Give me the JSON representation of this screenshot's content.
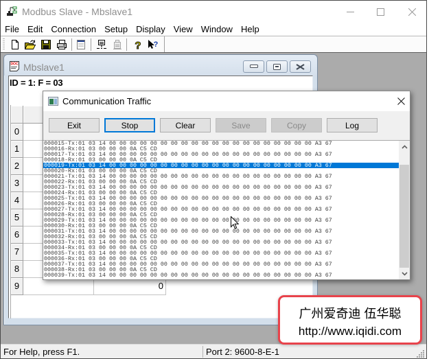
{
  "window": {
    "title": "Modbus Slave - Mbslave1",
    "controls": [
      "minimize",
      "maximize",
      "close"
    ]
  },
  "menu": {
    "items": [
      "File",
      "Edit",
      "Connection",
      "Setup",
      "Display",
      "View",
      "Window",
      "Help"
    ]
  },
  "toolbar": {
    "items": [
      {
        "icon": "new-document-icon",
        "enabled": true
      },
      {
        "icon": "open-folder-icon",
        "enabled": true
      },
      {
        "icon": "save-icon",
        "enabled": true
      },
      {
        "icon": "print-icon",
        "enabled": true
      },
      {
        "icon": "display-window-icon",
        "enabled": true
      },
      {
        "icon": "connect-icon",
        "enabled": true
      },
      {
        "icon": "disconnect-icon",
        "enabled": false
      },
      {
        "icon": "help-icon",
        "enabled": true
      },
      {
        "icon": "context-help-icon",
        "enabled": true
      }
    ]
  },
  "child_window": {
    "title": "Mbslave1",
    "info": "ID = 1: F = 03",
    "rows": [
      {
        "label": "0",
        "alias": "",
        "value": ""
      },
      {
        "label": "1",
        "alias": "",
        "value": ""
      },
      {
        "label": "2",
        "alias": "",
        "value": ""
      },
      {
        "label": "3",
        "alias": "",
        "value": ""
      },
      {
        "label": "4",
        "alias": "",
        "value": ""
      },
      {
        "label": "5",
        "alias": "",
        "value": ""
      },
      {
        "label": "6",
        "alias": "",
        "value": ""
      },
      {
        "label": "7",
        "alias": "",
        "value": ""
      },
      {
        "label": "8",
        "alias": "",
        "value": ""
      },
      {
        "label": "9",
        "alias": "",
        "value": "0"
      }
    ]
  },
  "traffic_dialog": {
    "title": "Communication Traffic",
    "buttons": [
      {
        "label": "Exit",
        "enabled": true,
        "focused": false
      },
      {
        "label": "Stop",
        "enabled": true,
        "focused": true
      },
      {
        "label": "Clear",
        "enabled": true,
        "focused": false
      },
      {
        "label": "Save",
        "enabled": false,
        "focused": false
      },
      {
        "label": "Copy",
        "enabled": false,
        "focused": false
      },
      {
        "label": "Log",
        "enabled": true,
        "focused": false
      }
    ],
    "lines": [
      "000015-Tx:01 03 14 00 00 00 00 00 00 00 00 00 00 00 00 00 00 00 00 00 00 00 00 A3 67",
      "000016-Rx:01 03 00 00 00 0A C5 CD",
      "000017-Tx:01 03 14 00 00 00 00 00 00 00 00 00 00 00 00 00 00 00 00 00 00 00 00 A3 67",
      "000018-Rx:01 03 00 00 00 0A C5 CD",
      "000019-Tx:01 03 14 00 00 00 00 00 00 00 00 00 00 00 00 00 00 00 00 00 00 00 00 A3 67",
      "000020-Rx:01 03 00 00 00 0A C5 CD",
      "000021-Tx:01 03 14 00 00 00 00 00 00 00 00 00 00 00 00 00 00 00 00 00 00 00 00 A3 67",
      "000022-Rx:01 03 00 00 00 0A C5 CD",
      "000023-Tx:01 03 14 00 00 00 00 00 00 00 00 00 00 00 00 00 00 00 00 00 00 00 00 A3 67",
      "000024-Rx:01 03 00 00 00 0A C5 CD",
      "000025-Tx:01 03 14 00 00 00 00 00 00 00 00 00 00 00 00 00 00 00 00 00 00 00 00 A3 67",
      "000026-Rx:01 03 00 00 00 0A C5 CD",
      "000027-Tx:01 03 14 00 00 00 00 00 00 00 00 00 00 00 00 00 00 00 00 00 00 00 00 A3 67",
      "000028-Rx:01 03 00 00 00 0A C5 CD",
      "000029-Tx:01 03 14 00 00 00 00 00 00 00 00 00 00 00 00 00 00 00 00 00 00 00 00 A3 67",
      "000030-Rx:01 03 00 00 00 0A C5 CD",
      "000031-Tx:01 03 14 00 00 00 00 00 00 00 00 00 00 00 00 00 00 00 00 00 00 00 00 A3 67",
      "000032-Rx:01 03 00 00 00 0A C5 CD",
      "000033-Tx:01 03 14 00 00 00 00 00 00 00 00 00 00 00 00 00 00 00 00 00 00 00 00 A3 67",
      "000034-Rx:01 03 00 00 00 0A C5 CD",
      "000035-Tx:01 03 14 00 00 00 00 00 00 00 00 00 00 00 00 00 00 00 00 00 00 00 00 A3 67",
      "000036-Rx:01 03 00 00 00 0A C5 CD",
      "000037-Tx:01 03 14 00 00 00 00 00 00 00 00 00 00 00 00 00 00 00 00 00 00 00 00 A3 67",
      "000038-Rx:01 03 00 00 00 0A C5 CD",
      "000039-Tx:01 03 14 00 00 00 00 00 00 00 00 00 00 00 00 00 00 00 00 00 00 00 00 A3 67"
    ],
    "selected_index": 4,
    "scrollbar": {
      "position": 1.0,
      "visible_fraction": 0.89
    }
  },
  "status_bar": {
    "help": "For Help, press F1.",
    "port": "Port 2: 9600-8-E-1"
  },
  "watermark": {
    "line1": "广州爱奇迪 伍华聪",
    "line2": "http://www.iqidi.com"
  },
  "colors": {
    "selection": "#0078d7",
    "focus_border": "#0078d7",
    "mdi_background": "#ababab",
    "watermark_border": "#e8434b"
  }
}
